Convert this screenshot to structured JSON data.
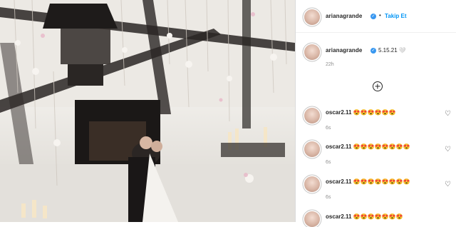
{
  "post": {
    "author": "arianagrande",
    "follow_label": "Takip Et",
    "separator": "•",
    "caption": "5.15.21 🤍",
    "caption_time": "22h",
    "load_more_icon": "plus-circle-icon",
    "verified_icon": "verified-badge-icon",
    "like_icon": "heart-outline-icon",
    "colors": {
      "link_blue": "#0095f6",
      "verified_blue": "#3897f0",
      "muted": "#8e8e8e",
      "text": "#262626"
    }
  },
  "comments": [
    {
      "user": "oscar2.11",
      "text": "😍😍😍😍😍😍",
      "time": "6s"
    },
    {
      "user": "oscar2.11",
      "text": "😍😍😍😍😍😍😍😍",
      "time": "6s"
    },
    {
      "user": "oscar2.11",
      "text": "😍😍😍😍😍😍😍😍",
      "time": "6s"
    },
    {
      "user": "oscar2.11",
      "text": "😍😍😍😍😍😍😍",
      "time": ""
    }
  ]
}
